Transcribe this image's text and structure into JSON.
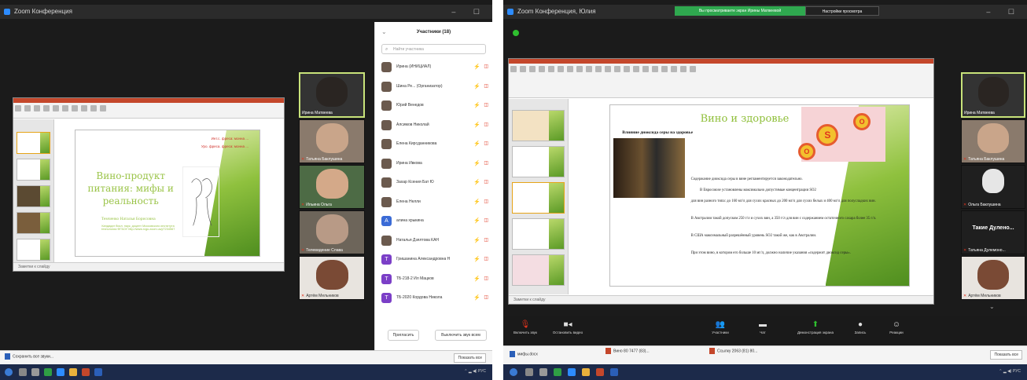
{
  "left": {
    "window_title": "Zoom Конференция",
    "slide": {
      "red_lines": [
        "Инт.с. фреса: монна ...",
        "Уро. фреса. фреса: монна ..."
      ],
      "title": "Вино-продукт питания: мифы и реальность",
      "author": "Темченко Наталья Борисовна",
      "info": "Кандидат биол. наук, доцент Московского института технологии ФГБОУ http://www.rcgu.zoom.us/j/7234567"
    },
    "notes_label": "Заметки к слайду",
    "videos": [
      {
        "name": "Ирина Матвеева",
        "active": true
      },
      {
        "name": "Татьяна Баклушина"
      },
      {
        "name": "Ильина Ольга"
      },
      {
        "name": "Телевидение Слава"
      },
      {
        "name": "Артём Мельников"
      }
    ],
    "participants": {
      "title": "Участники (18)",
      "search_placeholder": "Найти участника",
      "list": [
        {
          "initial": "",
          "name": "Ирина (ИНИЦИАЛ)"
        },
        {
          "initial": "",
          "name": "Шина Ре... (Организатор)"
        },
        {
          "initial": "",
          "name": "Юрий Венедов"
        },
        {
          "initial": "",
          "name": "Алсимов Николай"
        },
        {
          "initial": "",
          "name": "Елена Кирсданникова"
        },
        {
          "initial": "",
          "name": "Ирина Ивкова"
        },
        {
          "initial": "",
          "name": "Захар Ксения Бат Ю"
        },
        {
          "initial": "",
          "name": "Елена Нелли"
        },
        {
          "initial": "А",
          "name": "алина хрыкина"
        },
        {
          "initial": "",
          "name": "Наталья Дзялтова КАН"
        },
        {
          "initial": "Т",
          "name": "Гришанина Александровна Н"
        },
        {
          "initial": "Т",
          "name": "ТБ-218-2 Ил Мацков"
        },
        {
          "initial": "Т",
          "name": "ТБ-2020 Кордова Никола"
        }
      ],
      "invite_button": "Пригласить",
      "mute_all_button": "Выключить звук всем"
    },
    "download_item": "Сохранить все звуки...",
    "download_button": "Показать все"
  },
  "right": {
    "window_title": "Zoom Конференция, Юлия",
    "banner_green": "Вы просматриваете экран Ирины Матвеевой",
    "banner_dark": "Настройки просмотра",
    "slide": {
      "title": "Вино и здоровье",
      "subtitle": "Влияние диоксида серы на здоровье",
      "circle_letters": [
        "S",
        "O",
        "O"
      ],
      "paragraphs": [
        "Содержание диоксида серы в вине регламентируется законодательно.",
        "В Евросоюзе установлены максимально допустимые концентрации SO2",
        "для вин разного типа: до 160 мг/л для сухих красных до 200 мг/л для сухих белых и 400 мг/л для полусладких вин.",
        "В Австралии такой допуском 250 г/л и сухих вин, а 350 г/л для вин с содержанием остаточного сахара более 35 г/л.",
        "В США максимальный разрешённый уровень SO2 такой же, как в Австралии.",
        "При этом вино, в котором его больше 10 мг/л, должно наличие указания «содержит диоксид серы»."
      ]
    },
    "notes_label": "Заметки к слайду",
    "videos": [
      {
        "name": "Ирина Матвеева",
        "active": true
      },
      {
        "name": "Татьяна Баклушина"
      },
      {
        "name": "Ольга Баклушина"
      },
      {
        "name": "Татьяна Дулемоно..."
      },
      {
        "name": "Артём Мельников"
      }
    ],
    "big_name": "Такие Дулено...",
    "toolbar": [
      {
        "label": "Включить звук",
        "icon": "mic-muted-icon"
      },
      {
        "label": "Остановить видео",
        "icon": "video-icon"
      },
      {
        "label": "Участники",
        "icon": "participants-icon"
      },
      {
        "label": "Чат",
        "icon": "chat-icon"
      },
      {
        "label": "Демонстрация экрана",
        "icon": "share-screen-icon"
      },
      {
        "label": "Запись",
        "icon": "record-icon"
      },
      {
        "label": "Реакции",
        "icon": "reactions-icon"
      }
    ],
    "downloads": [
      "мифы.docx",
      "Вино 80 7477 (83)...",
      "Ссылку 2063 (81) 80..."
    ],
    "download_button": "Показать все"
  },
  "colors": {
    "accent_green": "#8fbf3a",
    "zoom_blue": "#2d8cff",
    "mic_red": "#e0341e"
  }
}
